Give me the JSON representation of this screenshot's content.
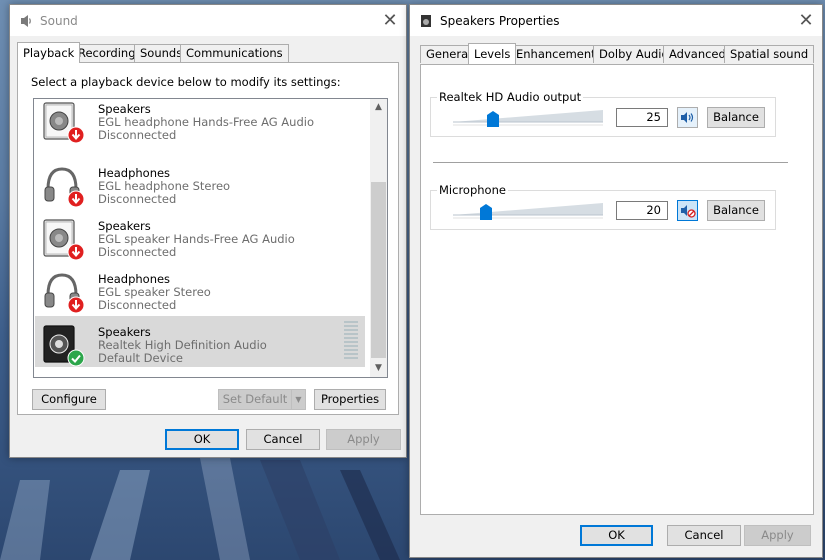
{
  "sound_window": {
    "title": "Sound",
    "close_glyph": "✕",
    "tabs": [
      {
        "label": "Playback",
        "active": true
      },
      {
        "label": "Recording",
        "active": false
      },
      {
        "label": "Sounds",
        "active": false
      },
      {
        "label": "Communications",
        "active": false
      }
    ],
    "instruction": "Select a playback device below to modify its settings:",
    "devices": [
      {
        "name": "Speakers",
        "description": "EGL headphone Hands-Free AG Audio",
        "status": "Disconnected",
        "icon": "speaker-icon",
        "badge": "disconnected",
        "selected": false
      },
      {
        "name": "Headphones",
        "description": "EGL headphone Stereo",
        "status": "Disconnected",
        "icon": "headphones-icon",
        "badge": "disconnected",
        "selected": false
      },
      {
        "name": "Speakers",
        "description": "EGL speaker Hands-Free AG Audio",
        "status": "Disconnected",
        "icon": "speaker-icon",
        "badge": "disconnected",
        "selected": false
      },
      {
        "name": "Headphones",
        "description": "EGL speaker Stereo",
        "status": "Disconnected",
        "icon": "headphones-icon",
        "badge": "disconnected",
        "selected": false
      },
      {
        "name": "Speakers",
        "description": "Realtek High Definition Audio",
        "status": "Default Device",
        "icon": "speaker-icon",
        "badge": "default",
        "selected": true
      }
    ],
    "buttons": {
      "configure": "Configure",
      "set_default": "Set Default",
      "properties": "Properties",
      "ok": "OK",
      "cancel": "Cancel",
      "apply": "Apply"
    }
  },
  "props_window": {
    "title": "Speakers Properties",
    "close_glyph": "✕",
    "tabs": [
      {
        "label": "General",
        "active": false
      },
      {
        "label": "Levels",
        "active": true
      },
      {
        "label": "Enhancements",
        "active": false
      },
      {
        "label": "Dolby Audio",
        "active": false
      },
      {
        "label": "Advanced",
        "active": false
      },
      {
        "label": "Spatial sound",
        "active": false
      }
    ],
    "levels": [
      {
        "label": "Realtek HD Audio output",
        "value": "25",
        "level": 25,
        "muted": false,
        "balance": "Balance"
      },
      {
        "label": "Microphone",
        "value": "20",
        "level": 20,
        "muted": true,
        "balance": "Balance"
      }
    ],
    "buttons": {
      "ok": "OK",
      "cancel": "Cancel",
      "apply": "Apply"
    }
  },
  "colors": {
    "accent": "#0078d7",
    "slider_thumb": "#0078d7",
    "default_badge": "#2ca64b",
    "disconnected_badge": "#e02020"
  }
}
